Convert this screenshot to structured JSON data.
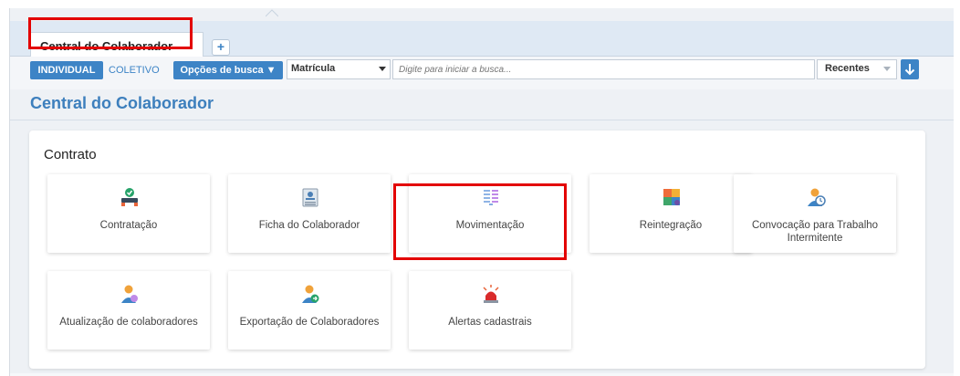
{
  "tabs": [
    {
      "label": "Central do Colaborador"
    }
  ],
  "new_tab_symbol": "+",
  "toolbar": {
    "individual_label": "INDIVIDUAL",
    "coletivo_label": "COLETIVO",
    "opcoes_label": "Opções de busca ▼",
    "search_field_selected": "Matrícula",
    "search_placeholder": "Digite para iniciar a busca...",
    "recentes_label": "Recentes",
    "down_icon": "arrow-down-icon"
  },
  "page": {
    "title": "Central do Colaborador"
  },
  "section": {
    "title": "Contrato",
    "tiles": [
      {
        "label": "Contratação",
        "icon": "person-check-icon"
      },
      {
        "label": "Ficha do Colaborador",
        "icon": "id-card-icon"
      },
      {
        "label": "Movimentação",
        "icon": "transfer-icon"
      },
      {
        "label": "Reintegração",
        "icon": "puzzle-icon"
      },
      {
        "label": "Convocação para Trabalho Intermitente",
        "icon": "person-clock-icon"
      },
      {
        "label": "Atualização de colaboradores",
        "icon": "person-refresh-icon"
      },
      {
        "label": "Exportação de Colaboradores",
        "icon": "person-export-icon"
      },
      {
        "label": "Alertas cadastrais",
        "icon": "alarm-icon"
      }
    ]
  },
  "colors": {
    "accent": "#3d84c6",
    "title": "#3d7fbd",
    "highlight": "#e30000"
  }
}
